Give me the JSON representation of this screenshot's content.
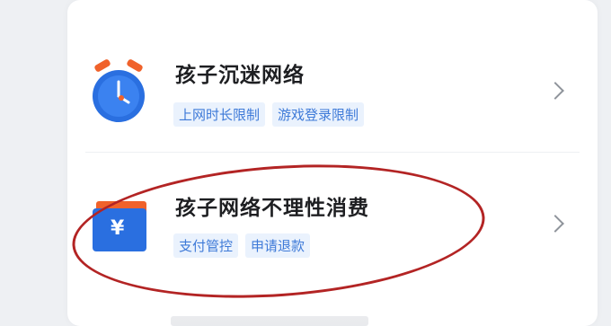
{
  "items": [
    {
      "title": "孩子沉迷网络",
      "tags": [
        "上网时长限制",
        "游戏登录限制"
      ],
      "icon": "alarm-clock-icon"
    },
    {
      "title": "孩子网络不理性消费",
      "tags": [
        "支付管控",
        "申请退款"
      ],
      "icon": "yuan-wallet-icon",
      "icon_text": "¥"
    }
  ],
  "colors": {
    "tag_bg": "#eaf2fd",
    "tag_text": "#3e7ad8",
    "title": "#1e1f22",
    "accent_blue": "#2a6fe0",
    "accent_orange": "#f0622b",
    "annotation_red": "#b32424"
  }
}
